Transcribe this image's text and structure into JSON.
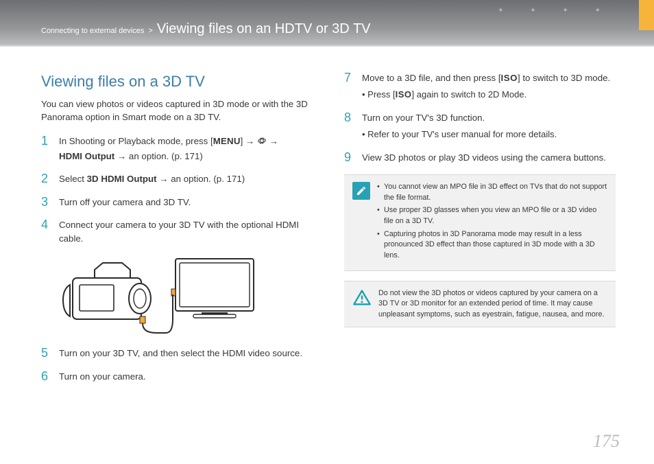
{
  "header": {
    "breadcrumb_section": "Connecting to external devices",
    "separator": ">",
    "title": "Viewing files on an HDTV or 3D TV"
  },
  "section_heading": "Viewing files on a 3D TV",
  "intro": "You can view photos or videos captured in 3D mode or with the 3D Panorama option in Smart mode on a 3D TV.",
  "step1_a": "In Shooting or Playback mode, press [",
  "menu_label": "MENU",
  "step1_b": "] → ",
  "step1_c": " →",
  "step1_d_bold": "HDMI Output",
  "step1_e": " → an option. (p. 171)",
  "step2_a": "Select ",
  "step2_bold": "3D HDMI Output",
  "step2_b": " → an option. (p. 171)",
  "step3": "Turn off your camera and 3D TV.",
  "step4": "Connect your camera to your 3D TV with the optional HDMI cable.",
  "step5": "Turn on your 3D TV, and then select the HDMI video source.",
  "step6": "Turn on your camera.",
  "step7_a": "Move to a 3D file, and then press [",
  "iso_label": "ISO",
  "step7_b": "] to switch to 3D mode.",
  "step7_sub_a": "Press [",
  "step7_sub_b": "] again to switch to 2D Mode.",
  "step8": "Turn on your TV's 3D function.",
  "step8_sub": "Refer to your TV's user manual for more details.",
  "step9": "View 3D photos or play 3D videos using the camera buttons.",
  "note_items": [
    "You cannot view an MPO file in 3D effect on TVs that do not support the file format.",
    "Use proper 3D glasses when you view an MPO file or a 3D video file on a 3D TV.",
    "Capturing photos in 3D Panorama mode may result in a less pronounced 3D effect than those captured in 3D mode with a 3D lens."
  ],
  "warning_text": "Do not view the 3D photos or videos captured by your camera on a 3D TV or 3D monitor for an extended period of time. It may cause unpleasant symptoms, such as eyestrain, fatigue, nausea, and more.",
  "page_number": "175",
  "step_numbers": [
    "1",
    "2",
    "3",
    "4",
    "5",
    "6",
    "7",
    "8",
    "9"
  ]
}
